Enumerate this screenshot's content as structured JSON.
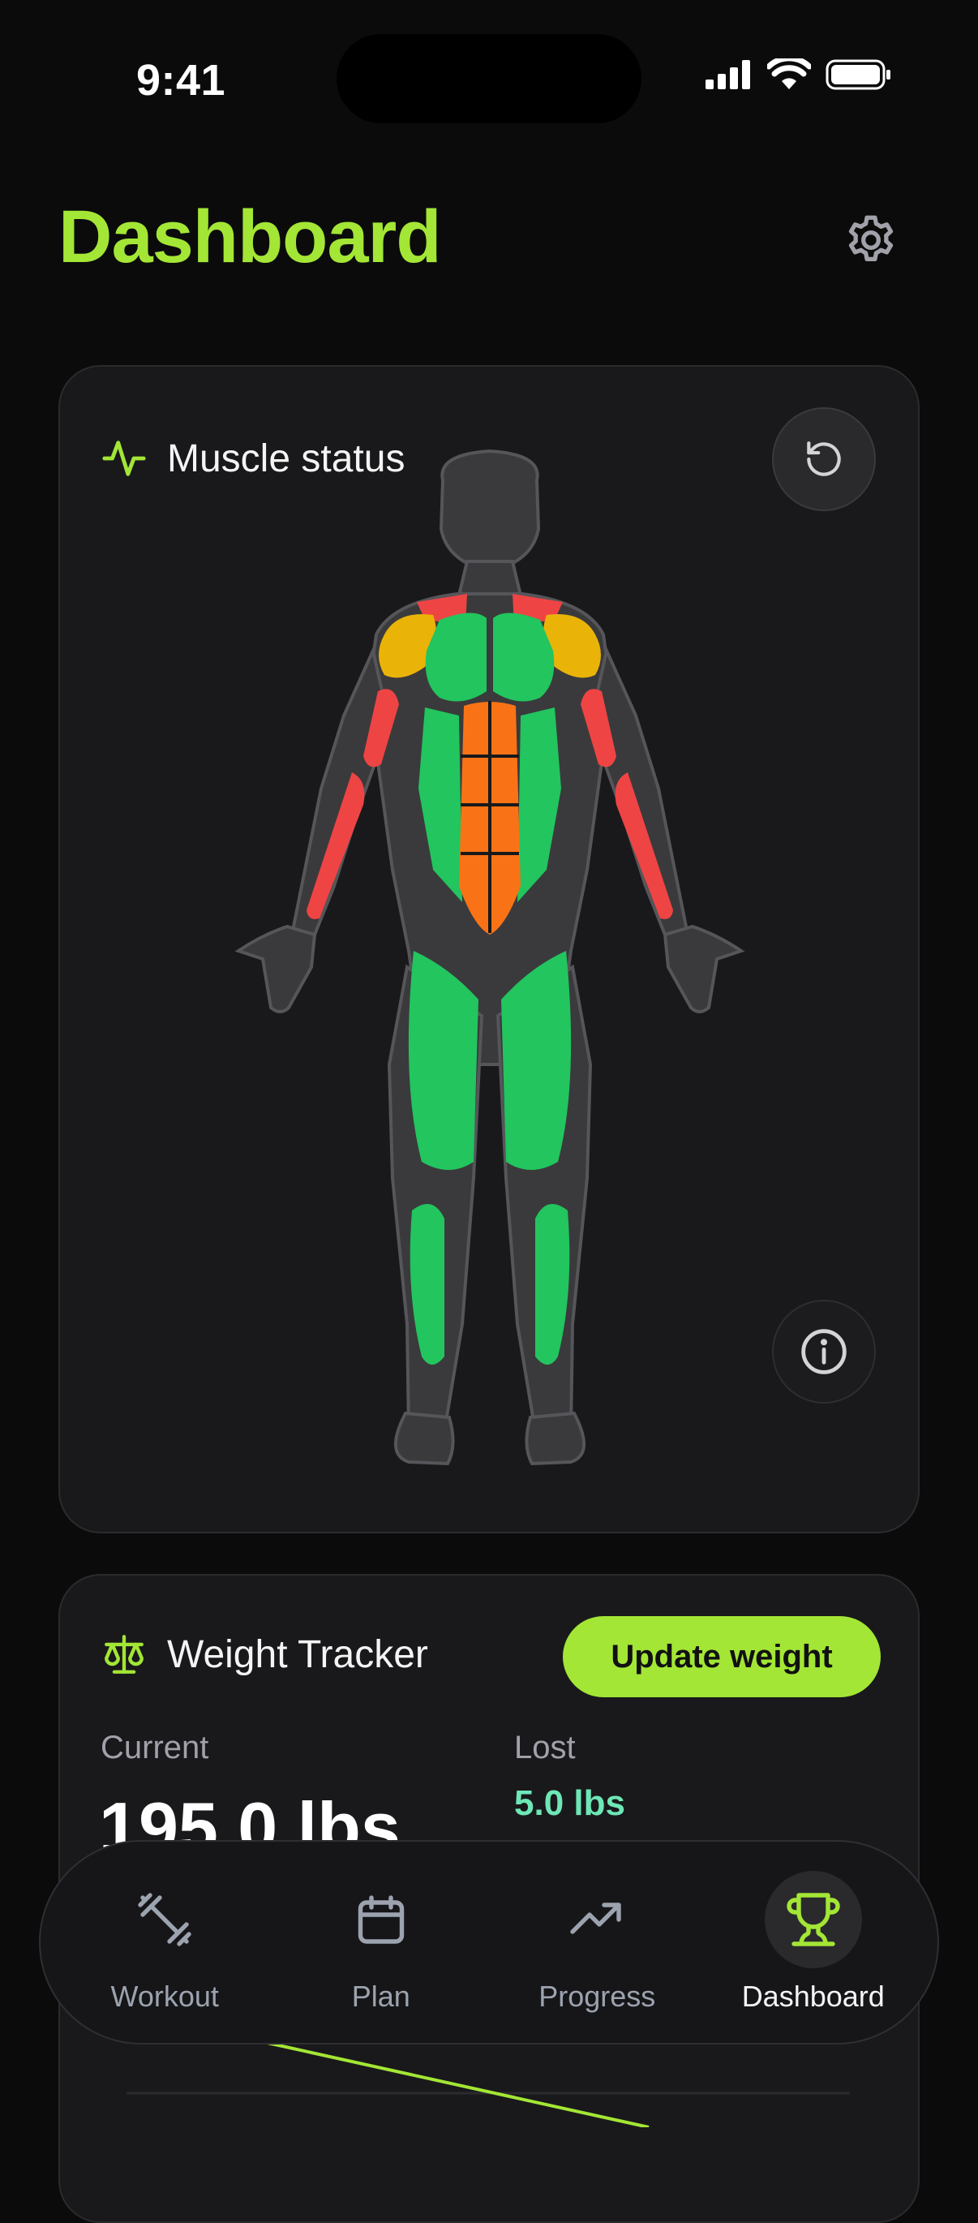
{
  "status_bar": {
    "time": "9:41"
  },
  "header": {
    "title": "Dashboard"
  },
  "muscle_card": {
    "title": "Muscle status"
  },
  "weight_card": {
    "title": "Weight Tracker",
    "update_label": "Update weight",
    "current_label": "Current",
    "current_value": "195.0 lbs",
    "lost_label": "Lost",
    "lost_value": "5.0 lbs"
  },
  "tabs": [
    {
      "label": "Workout",
      "icon": "dumbbell-icon",
      "active": false
    },
    {
      "label": "Plan",
      "icon": "calendar-icon",
      "active": false
    },
    {
      "label": "Progress",
      "icon": "trending-up-icon",
      "active": false
    },
    {
      "label": "Dashboard",
      "icon": "trophy-icon",
      "active": true
    }
  ],
  "colors": {
    "accent": "#a3e635",
    "recovered": "#22c55e",
    "moderate": "#eab308",
    "fatigued": "#f97316",
    "sore": "#ef4444",
    "lost": "#6ee7b7"
  }
}
